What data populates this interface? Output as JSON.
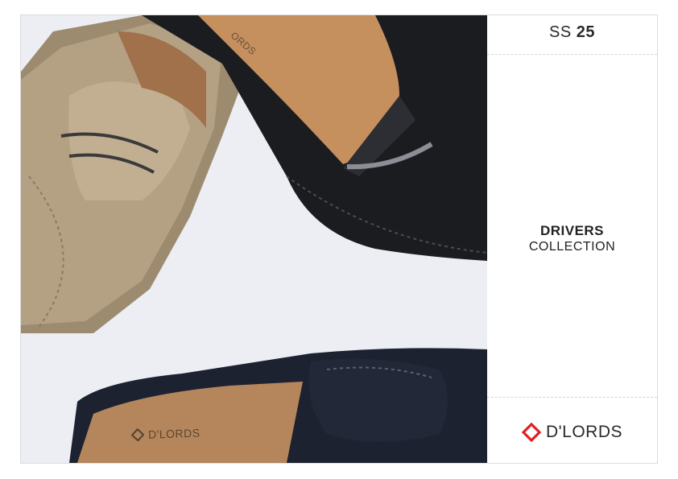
{
  "season": {
    "prefix": "SS",
    "year": "25"
  },
  "collection": {
    "line1": "DRIVERS",
    "line2": "COLLECTION"
  },
  "brand": {
    "name": "D'LORDS",
    "accent_color": "#e02020"
  },
  "photo": {
    "insole_print_bottom": "D'LORDS",
    "insole_print_top": "ORDS"
  },
  "colors": {
    "background": "#eceef3",
    "tan_suede": "#b4a184",
    "black_leather": "#1b1c20",
    "navy_suede": "#1d2230",
    "insole": "#c58f5e"
  }
}
